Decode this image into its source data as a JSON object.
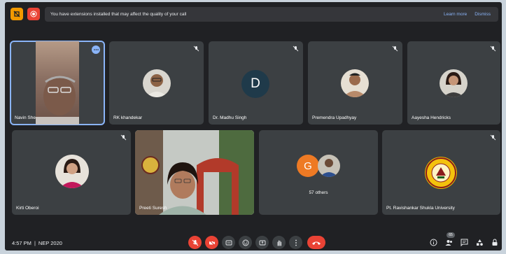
{
  "banner": {
    "message": "You have extensions installed that may affect the quality of your call",
    "learn_more": "Learn more",
    "dismiss": "Dismiss"
  },
  "participants": [
    {
      "name": "Navin She",
      "initial": ""
    },
    {
      "name": "RK khandekar",
      "initial": ""
    },
    {
      "name": "Dr. Madhu Singh",
      "initial": "D"
    },
    {
      "name": "Premendra Upadhyay",
      "initial": ""
    },
    {
      "name": "Aayesha Hendricks",
      "initial": ""
    },
    {
      "name": "Kirti Oberoi",
      "initial": ""
    },
    {
      "name": "Preeti Suresh",
      "initial": ""
    },
    {
      "name": "57 others",
      "initial": "G"
    },
    {
      "name": "Pt. Ravishankar Shukla University",
      "initial": ""
    }
  ],
  "footer": {
    "time": "4:57 PM",
    "separator": "|",
    "meeting_name": "NEP 2020",
    "people_count": "65"
  },
  "colors": {
    "background": "#202124",
    "tile": "#3c4043",
    "accent": "#8ab4f8",
    "danger": "#ea4335",
    "avatar_g": "#ee7a24",
    "avatar_d": "#1f3a4a"
  }
}
